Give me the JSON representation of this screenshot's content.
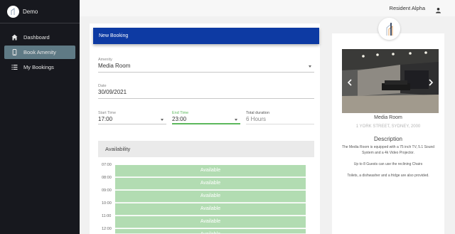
{
  "brand": {
    "name": "Demo"
  },
  "sidebar": {
    "items": [
      {
        "label": "Dashboard",
        "icon": "home-icon"
      },
      {
        "label": "Book Amenity",
        "icon": "phone-icon",
        "active": true
      },
      {
        "label": "My Bookings",
        "icon": "list-icon"
      }
    ]
  },
  "topbar": {
    "user_name": "Resident Alpha"
  },
  "booking": {
    "header": "New Booking",
    "amenity": {
      "label": "Amenity",
      "value": "Media Room"
    },
    "date": {
      "label": "Date",
      "value": "30/09/2021"
    },
    "start_time": {
      "label": "Start Time",
      "value": "17:00"
    },
    "end_time": {
      "label": "End Time",
      "value": "23:00"
    },
    "duration": {
      "label": "Total duration",
      "value": "6 Hours"
    },
    "availability": {
      "title": "Availability",
      "slots": [
        {
          "time": "07:00",
          "status": "Available"
        },
        {
          "time": "08:00",
          "status": "Available"
        },
        {
          "time": "09:00",
          "status": "Available"
        },
        {
          "time": "10:00",
          "status": "Available"
        },
        {
          "time": "11:00",
          "status": "Available"
        },
        {
          "time": "12:00",
          "status": "Available"
        }
      ]
    }
  },
  "amenity_card": {
    "name": "Media Room",
    "address": "1 YORK STREET, SYDNEY, 2000",
    "description_title": "Description",
    "description": [
      "The Media Room is equipped with a 75 inch TV, 5.1 Sound System and a 4k Video Projector.",
      "Up to 8 Guests can use the reclining Chairs",
      "Toilets, a dishwasher and a fridge are also provided."
    ]
  },
  "colors": {
    "sidebar_bg": "#17181e",
    "active_item": "#5f7a85",
    "header_blue": "#0d3aa3",
    "available_green": "#b2dcb2",
    "end_time_accent": "#5cb85c"
  }
}
